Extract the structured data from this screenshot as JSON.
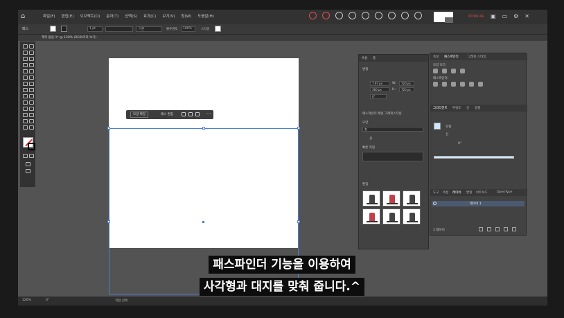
{
  "menubar": {
    "menus": [
      "파일(F)",
      "편집(E)",
      "오브젝트(O)",
      "문자(T)",
      "선택(S)",
      "효과(C)",
      "보기(V)",
      "창(W)",
      "도움말(H)"
    ],
    "rec_label": "00:00:41"
  },
  "control": {
    "label": "패스",
    "stroke_weight": "1 pt",
    "stroke_style": "기본",
    "opacity_label": "불투명도",
    "opacity": "100%",
    "style_label": "스타일"
  },
  "doc_tab": "제목 없음-1* @ 120% (RGB/미리 보기)",
  "context_bar": {
    "button1": "모양 확장",
    "button2": "패스 편집"
  },
  "properties": {
    "tabs": [
      "속성",
      "층"
    ],
    "section_transform": "변형",
    "w_label": "W:",
    "w_value": "720 px",
    "h_label": "H:",
    "h_value": "720 px",
    "x_value": "7.97 px",
    "y_value": "360 px",
    "angle": "0°",
    "section_appearance": "모양",
    "pathfinder_hint": "패스파인더 패널 그래픽스타일",
    "fill_label": "칠",
    "stroke_label": "선",
    "section_quick": "빠른 작업",
    "section_assets": "편집"
  },
  "right_panel": {
    "top_tabs": [
      "속성",
      "패스파인더",
      "그래픽 스타일"
    ],
    "shape_modes": "모양 모드:",
    "pathfinders": "패스파인더:",
    "gradient_tabs": [
      "그라디언트",
      "투명도",
      "선",
      "정렬"
    ],
    "gradient_type": "유형",
    "gradient_stroke": "선",
    "gradient_angle": "0°",
    "bottom_tabs": [
      "도구",
      "속성",
      "레이어",
      "변형",
      "아트보드",
      "OpenType"
    ],
    "layer_name": "레이어 1",
    "layer_count": "1 레이어"
  },
  "status": {
    "zoom": "120%",
    "angle": "0°",
    "tool": "직접 선택"
  },
  "subtitle": {
    "line1": "패스파인더 기능을 이용하여",
    "line2": "사각형과 대지를 맞춰 줍니다.^"
  }
}
